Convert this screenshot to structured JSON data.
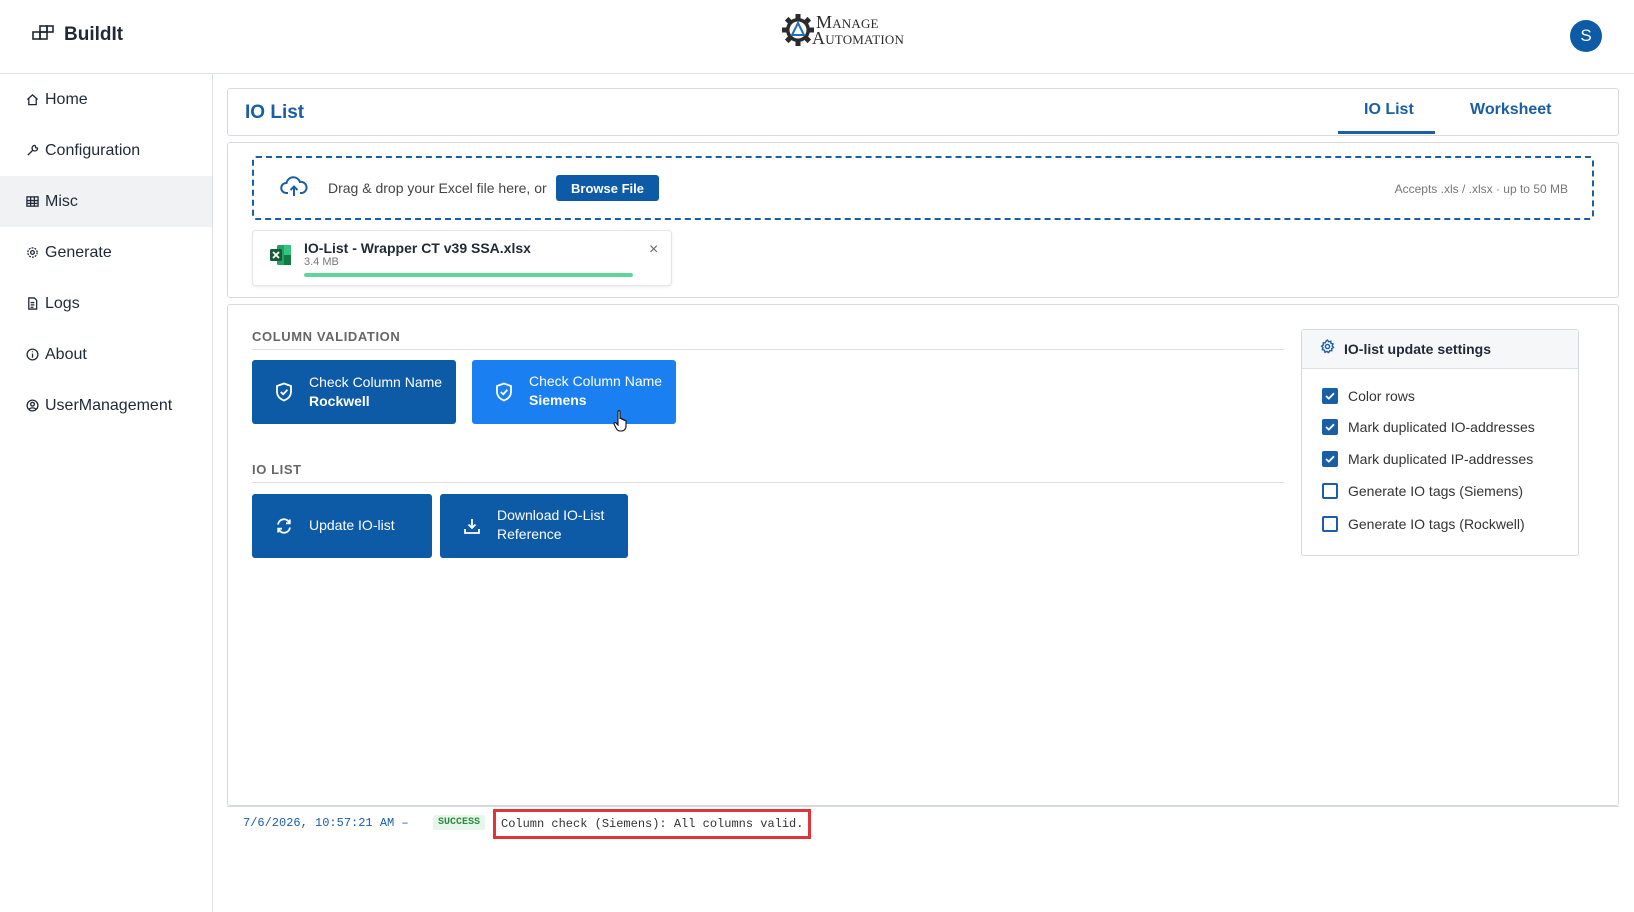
{
  "app": {
    "name": "BuildIt",
    "logo_line1": "Manage",
    "logo_line2": "Automation",
    "avatar_initial": "S",
    "brand_color": "#0d5aa7"
  },
  "sidebar": {
    "items": [
      {
        "label": "Home",
        "icon": "home-icon"
      },
      {
        "label": "Configuration",
        "icon": "wrench-icon"
      },
      {
        "label": "Misc",
        "icon": "grid-icon",
        "active": true
      },
      {
        "label": "Generate",
        "icon": "gear-icon"
      },
      {
        "label": "Logs",
        "icon": "document-icon"
      },
      {
        "label": "About",
        "icon": "info-icon"
      },
      {
        "label": "UserManagement",
        "icon": "user-circle-icon"
      }
    ]
  },
  "header": {
    "title": "IO List",
    "tabs": [
      {
        "label": "IO List",
        "active": true
      },
      {
        "label": "Worksheet",
        "active": false
      }
    ]
  },
  "upload": {
    "prompt": "Drag & drop your Excel file here, or",
    "browse_label": "Browse File",
    "accepts": "Accepts .xls / .xlsx · up to 50 MB",
    "file": {
      "name": "IO-List - Wrapper CT v39 SSA.xlsx",
      "size": "3.4 MB",
      "progress": 1.0,
      "close": "×"
    }
  },
  "validation": {
    "section_title": "COLUMN VALIDATION",
    "buttons": [
      {
        "line1": "Check Column Name",
        "line2": "Rockwell"
      },
      {
        "line1": "Check Column Name",
        "line2": "Siemens"
      }
    ]
  },
  "io_list": {
    "section_title": "IO LIST",
    "buttons": [
      {
        "label": "Update IO-list"
      },
      {
        "line1": "Download IO-List",
        "line2": "Reference"
      }
    ]
  },
  "settings": {
    "title": "IO-list update settings",
    "options": [
      {
        "label": "Color rows",
        "checked": true
      },
      {
        "label": "Mark duplicated IO-addresses",
        "checked": true
      },
      {
        "label": "Mark duplicated IP-addresses",
        "checked": true
      },
      {
        "label": "Generate IO tags (Siemens)",
        "checked": false
      },
      {
        "label": "Generate IO tags (Rockwell)",
        "checked": false
      }
    ]
  },
  "log": {
    "timestamp": "7/6/2026, 10:57:21 AM –",
    "status": "SUCCESS",
    "message": "Column check (Siemens): All columns valid."
  }
}
